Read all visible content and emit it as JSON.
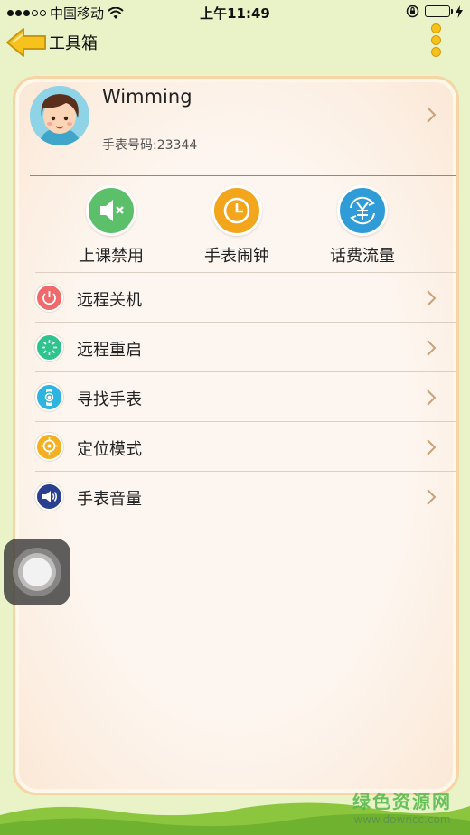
{
  "status_bar": {
    "carrier": "中国移动",
    "time": "上午11:49"
  },
  "nav": {
    "title": "工具箱"
  },
  "profile": {
    "name": "Wimming",
    "watch_number": "手表号码:23344"
  },
  "quick_actions": [
    {
      "label": "上课禁用",
      "icon": "mute-speaker-icon",
      "color": "#5cbf6a"
    },
    {
      "label": "手表闹钟",
      "icon": "alarm-clock-icon",
      "color": "#f3a51b"
    },
    {
      "label": "话费流量",
      "icon": "yuan-refresh-icon",
      "color": "#2f9bd7"
    }
  ],
  "menu_items": [
    {
      "label": "远程关机",
      "icon": "power-icon",
      "color": "#ef6a6a"
    },
    {
      "label": "远程重启",
      "icon": "restart-icon",
      "color": "#2fc48d"
    },
    {
      "label": "寻找手表",
      "icon": "watch-search-icon",
      "color": "#2fb4e0"
    },
    {
      "label": "定位模式",
      "icon": "location-icon",
      "color": "#f3b023"
    },
    {
      "label": "手表音量",
      "icon": "volume-icon",
      "color": "#2a3f8f"
    }
  ],
  "watermark": {
    "title": "绿色资源网",
    "url": "www.downcc.com"
  },
  "colors": {
    "background": "#eaf3c8",
    "accent": "#f7c21c",
    "card_border": "#f6d4a6",
    "chevron": "#c9a27a"
  }
}
